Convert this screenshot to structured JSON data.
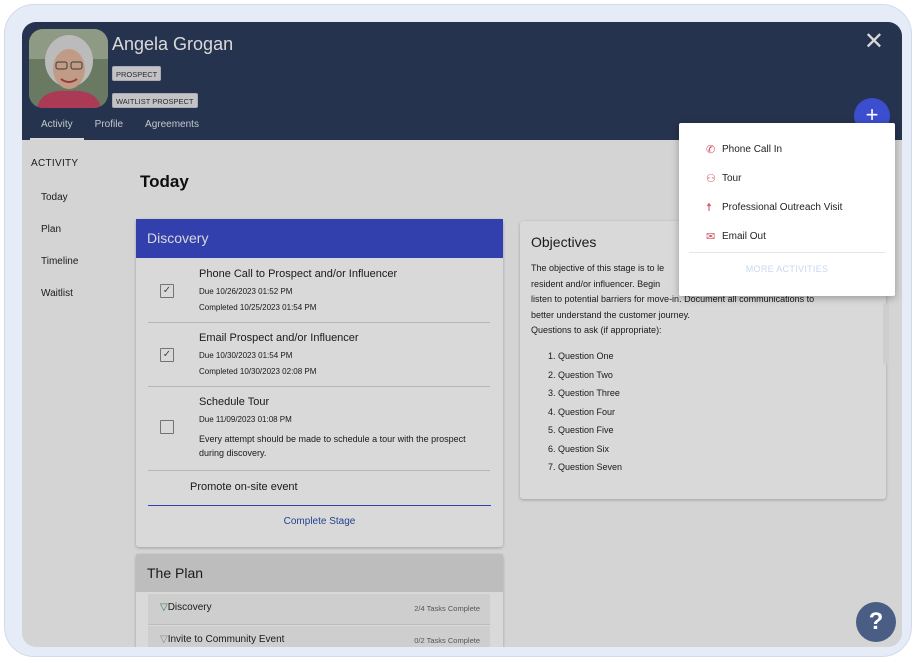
{
  "header": {
    "name": "Angela Grogan",
    "tags": [
      "PROSPECT",
      "WAITLIST PROSPECT"
    ],
    "tabs": [
      "Activity",
      "Profile",
      "Agreements"
    ],
    "close_icon": "close-icon",
    "fab_label": "+"
  },
  "sidebar": {
    "heading": "ACTIVITY",
    "items": [
      "Today",
      "Plan",
      "Timeline",
      "Waitlist"
    ]
  },
  "main": {
    "title": "Today",
    "discovery": {
      "header": "Discovery",
      "tasks": [
        {
          "title": "Phone Call to Prospect and/or Influencer",
          "due": "Due 10/26/2023 01:52 PM",
          "completed": "Completed 10/25/2023 01:54 PM",
          "checked": true
        },
        {
          "title": "Email Prospect and/or Influencer",
          "due": "Due 10/30/2023 01:54 PM",
          "completed": "Completed 10/30/2023 02:08 PM",
          "checked": true
        },
        {
          "title": "Schedule Tour",
          "due": "Due 11/09/2023 01:08 PM",
          "description": "Every attempt should be made to schedule a tour with the prospect during discovery.",
          "checked": false
        }
      ],
      "promote": "Promote on-site event",
      "complete_stage": "Complete Stage"
    },
    "objectives": {
      "title": "Objectives",
      "text_lines": [
        "The objective of this stage is to le",
        "resident and/or influencer. Begin",
        "listen to potential barriers for move-in. Document all communications to",
        "better understand the customer journey."
      ],
      "questions_label": "Questions to ask (if appropriate):",
      "questions": [
        "Question One",
        "Question Two",
        "Question Three",
        "Question Four",
        "Question Five",
        "Question Six",
        "Question Seven"
      ]
    },
    "plan": {
      "header": "The Plan",
      "rows": [
        {
          "name": "Discovery",
          "count": "2/4 Tasks Complete"
        },
        {
          "name": "Invite to Community Event",
          "count": "0/2 Tasks Complete"
        }
      ]
    }
  },
  "menu": {
    "items": [
      {
        "label": "Phone Call In",
        "icon": "phone-icon"
      },
      {
        "label": "Tour",
        "icon": "people-icon"
      },
      {
        "label": "Professional Outreach Visit",
        "icon": "person-outreach-icon"
      },
      {
        "label": "Email Out",
        "icon": "envelope-icon"
      }
    ],
    "more": "MORE ACTIVITIES"
  },
  "help_label": "?",
  "colors": {
    "header": "#2d3d5c",
    "accent": "#3a4ccc",
    "menu_icon": "#d04a5a"
  }
}
